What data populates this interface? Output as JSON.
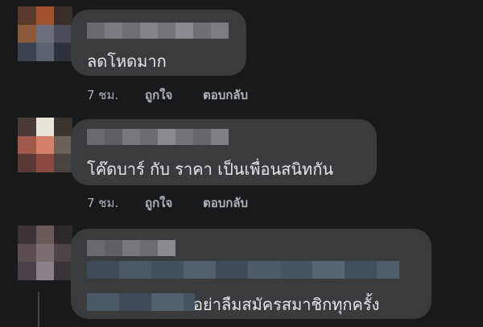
{
  "comments": [
    {
      "text": "ลดโหดมาก",
      "time": "7 ชม.",
      "like": "ถูกใจ",
      "reply": "ตอบกลับ"
    },
    {
      "text": "โค๊ดบาร์ กับ ราคา  เป็นเพื่อนสนิทกัน",
      "time": "7 ชม.",
      "like": "ถูกใจ",
      "reply": "ตอบกลับ"
    },
    {
      "text": "อย่าลืมสมัครสมาชิกทุกครั้ง"
    }
  ]
}
